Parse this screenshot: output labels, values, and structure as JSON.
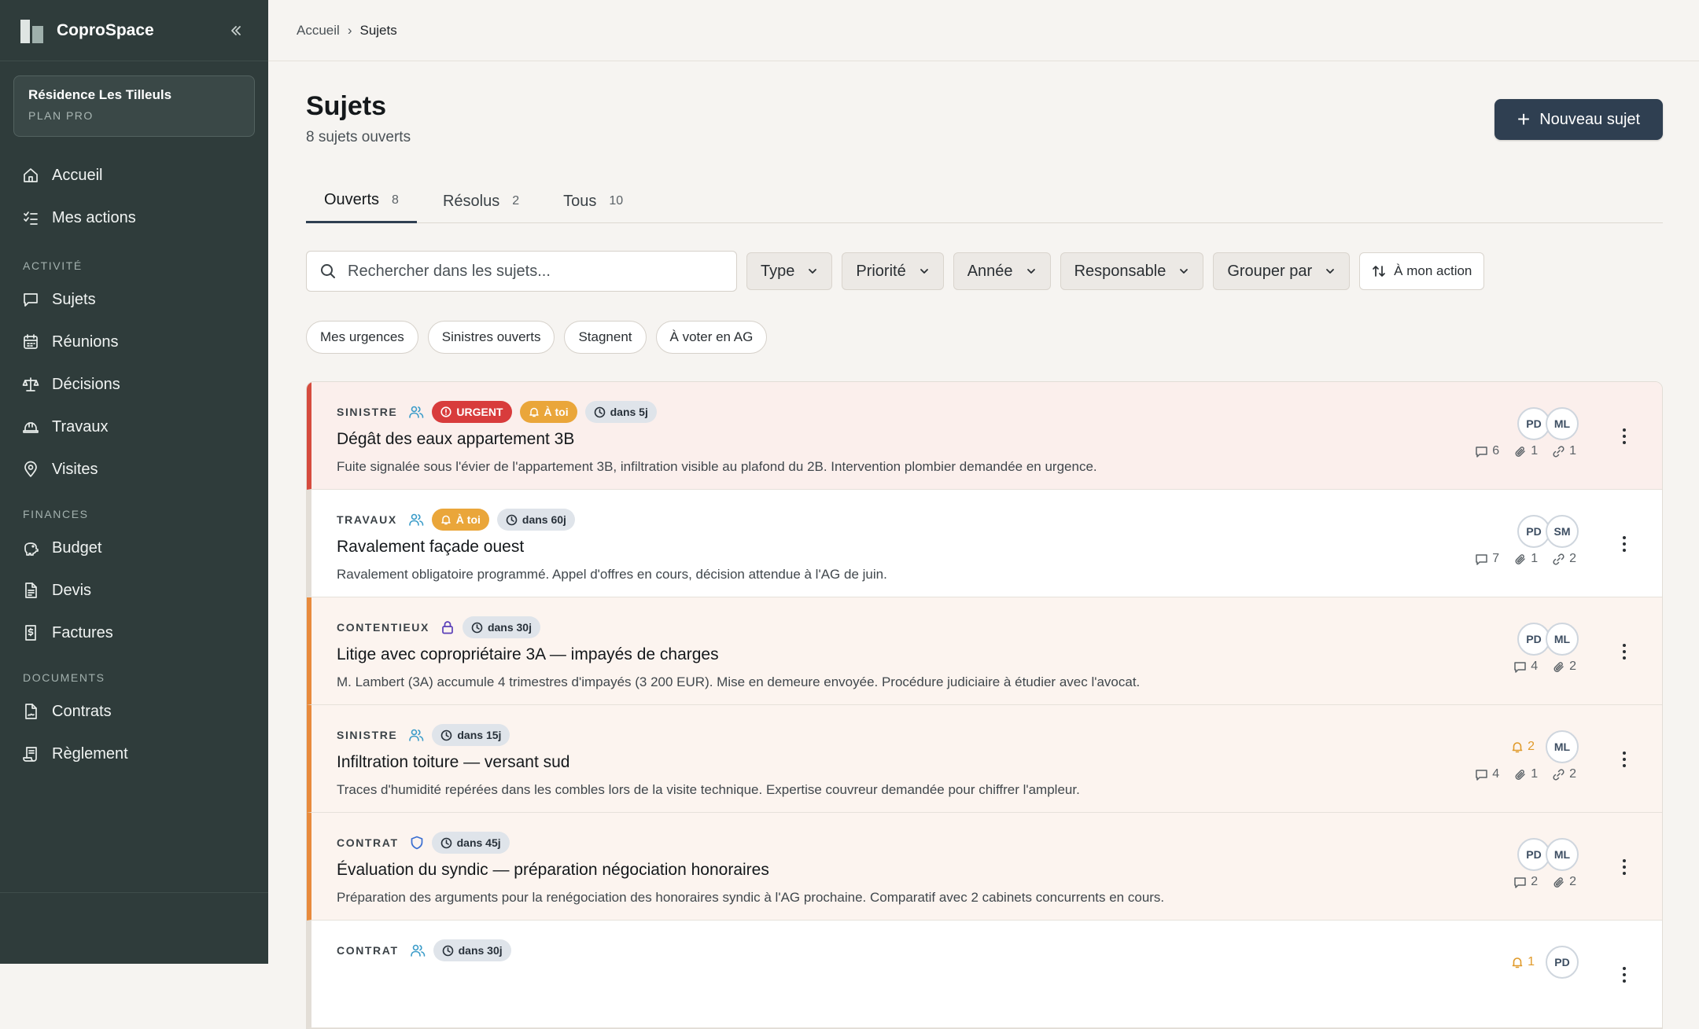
{
  "app": {
    "name": "CoproSpace"
  },
  "residence": {
    "name": "Résidence Les Tilleuls",
    "plan": "PLAN PRO"
  },
  "nav": {
    "main": [
      {
        "label": "Accueil",
        "icon": "home-icon"
      },
      {
        "label": "Mes actions",
        "icon": "checklist-icon"
      }
    ],
    "sections": [
      {
        "title": "ACTIVITÉ",
        "items": [
          {
            "label": "Sujets",
            "icon": "message-square-icon"
          },
          {
            "label": "Réunions",
            "icon": "calendar-icon"
          },
          {
            "label": "Décisions",
            "icon": "scale-icon"
          },
          {
            "label": "Travaux",
            "icon": "hard-hat-icon"
          },
          {
            "label": "Visites",
            "icon": "map-pin-icon"
          }
        ]
      },
      {
        "title": "FINANCES",
        "items": [
          {
            "label": "Budget",
            "icon": "piggy-bank-icon"
          },
          {
            "label": "Devis",
            "icon": "document-icon"
          },
          {
            "label": "Factures",
            "icon": "receipt-dollar-icon"
          }
        ]
      },
      {
        "title": "DOCUMENTS",
        "items": [
          {
            "label": "Contrats",
            "icon": "file-signature-icon"
          },
          {
            "label": "Règlement",
            "icon": "scroll-icon"
          }
        ]
      }
    ]
  },
  "breadcrumb": {
    "home": "Accueil",
    "sep": "›",
    "current": "Sujets"
  },
  "page": {
    "title": "Sujets",
    "subtitle": "8 sujets ouverts",
    "new_button": "Nouveau sujet"
  },
  "tabs": [
    {
      "label": "Ouverts",
      "count": "8",
      "active": true
    },
    {
      "label": "Résolus",
      "count": "2",
      "active": false
    },
    {
      "label": "Tous",
      "count": "10",
      "active": false
    }
  ],
  "search": {
    "placeholder": "Rechercher dans les sujets..."
  },
  "filters": {
    "type": "Type",
    "priority": "Priorité",
    "year": "Année",
    "owner": "Responsable",
    "group": "Grouper par",
    "my_action": "À mon action"
  },
  "quick_chips": [
    "Mes urgences",
    "Sinistres ouverts",
    "Stagnent",
    "À voter en AG"
  ],
  "colors": {
    "sidebar": "#2f3c3b",
    "primary": "#2f3f51",
    "urgent": "#d83c3c",
    "warning": "#eaa63a",
    "accent_orange": "#e88a3c"
  },
  "topics": [
    {
      "category": "SINISTRE",
      "cat_icon": "users-icon",
      "urgent": "URGENT",
      "toi": "À toi",
      "due": "dans 5j",
      "title": "Dégât des eaux appartement 3B",
      "desc": "Fuite signalée sous l'évier de l'appartement 3B, infiltration visible au plafond du 2B. Intervention plombier demandée en urgence.",
      "avatars": [
        "PD",
        "ML"
      ],
      "bell": "",
      "comments": "6",
      "attachments": "1",
      "links": "1",
      "style": "urgent"
    },
    {
      "category": "TRAVAUX",
      "cat_icon": "users-icon",
      "urgent": "",
      "toi": "À toi",
      "due": "dans 60j",
      "title": "Ravalement façade ouest",
      "desc": "Ravalement obligatoire programmé. Appel d'offres en cours, décision attendue à l'AG de juin.",
      "avatars": [
        "PD",
        "SM"
      ],
      "bell": "",
      "comments": "7",
      "attachments": "1",
      "links": "2",
      "style": "plain"
    },
    {
      "category": "CONTENTIEUX",
      "cat_icon": "lock-icon",
      "urgent": "",
      "toi": "",
      "due": "dans 30j",
      "title": "Litige avec copropriétaire 3A — impayés de charges",
      "desc": "M. Lambert (3A) accumule 4 trimestres d'impayés (3 200 EUR). Mise en demeure envoyée. Procédure judiciaire à étudier avec l'avocat.",
      "avatars": [
        "PD",
        "ML"
      ],
      "bell": "",
      "comments": "4",
      "attachments": "2",
      "links": "",
      "style": "warm"
    },
    {
      "category": "SINISTRE",
      "cat_icon": "users-icon",
      "urgent": "",
      "toi": "",
      "due": "dans 15j",
      "title": "Infiltration toiture — versant sud",
      "desc": "Traces d'humidité repérées dans les combles lors de la visite technique. Expertise couvreur demandée pour chiffrer l'ampleur.",
      "avatars": [
        "ML"
      ],
      "bell": "2",
      "comments": "4",
      "attachments": "1",
      "links": "2",
      "style": "warm"
    },
    {
      "category": "CONTRAT",
      "cat_icon": "shield-icon",
      "urgent": "",
      "toi": "",
      "due": "dans 45j",
      "title": "Évaluation du syndic — préparation négociation honoraires",
      "desc": "Préparation des arguments pour la renégociation des honoraires syndic à l'AG prochaine. Comparatif avec 2 cabinets concurrents en cours.",
      "avatars": [
        "PD",
        "ML"
      ],
      "bell": "",
      "comments": "2",
      "attachments": "2",
      "links": "",
      "style": "warm"
    },
    {
      "category": "CONTRAT",
      "cat_icon": "users-icon",
      "urgent": "",
      "toi": "",
      "due": "dans 30j",
      "title": "",
      "desc": "",
      "avatars": [
        "PD"
      ],
      "bell": "1",
      "comments": "",
      "attachments": "",
      "links": "",
      "style": "plain"
    }
  ]
}
